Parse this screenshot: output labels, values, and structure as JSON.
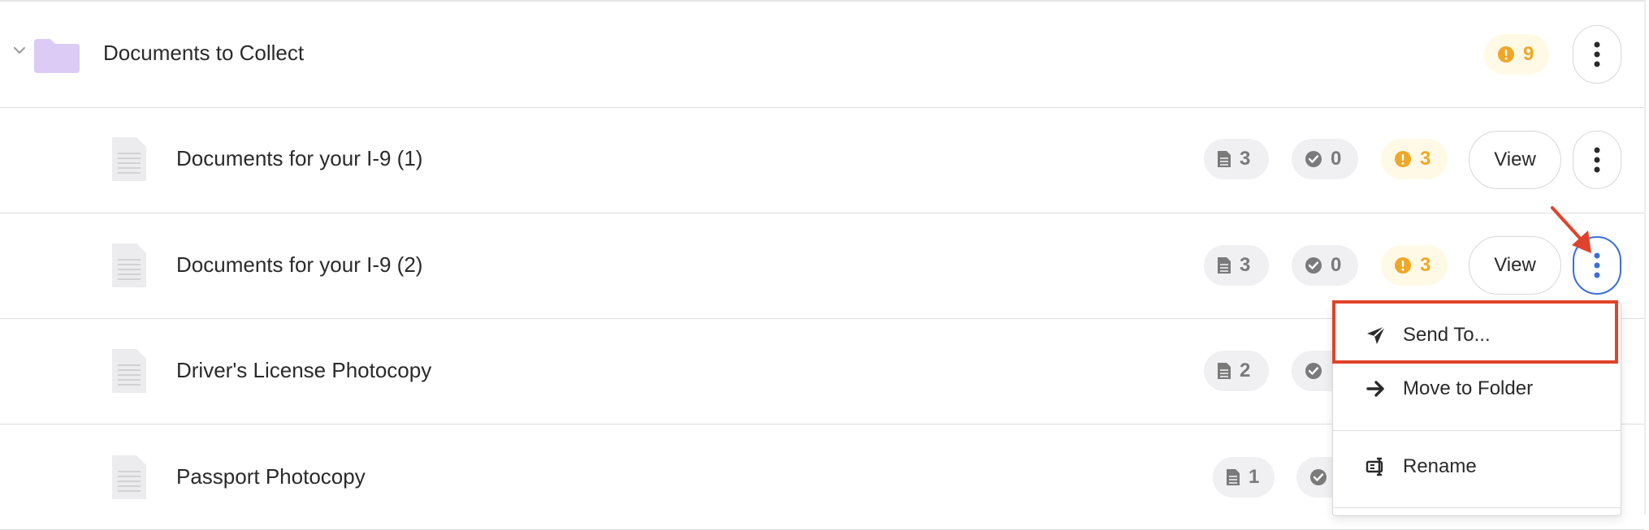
{
  "folder": {
    "title": "Documents to Collect",
    "warning_count": "9",
    "icon": "folder-icon"
  },
  "rows": [
    {
      "title": "Documents for your I-9 (1)",
      "files": "3",
      "approved": "0",
      "warnings": "3",
      "view_label": "View"
    },
    {
      "title": "Documents for your I-9 (2)",
      "files": "3",
      "approved": "0",
      "warnings": "3",
      "view_label": "View"
    },
    {
      "title": "Driver's License Photocopy",
      "files": "2"
    },
    {
      "title": "Passport Photocopy",
      "files": "1"
    }
  ],
  "menu": {
    "send_to": "Send To...",
    "move_to_folder": "Move to Folder",
    "rename": "Rename"
  },
  "colors": {
    "warning": "#f0a727",
    "highlight": "#e0432b",
    "active_border": "#3a6fd8",
    "folder": "#dccbf5"
  }
}
